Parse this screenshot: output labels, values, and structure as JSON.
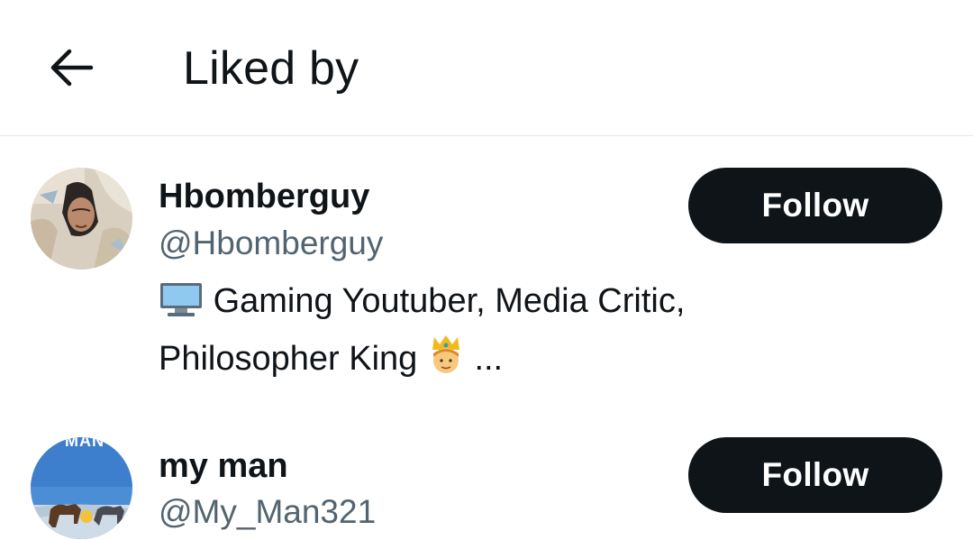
{
  "header": {
    "title": "Liked by",
    "back_icon": "arrow-left-icon"
  },
  "users": [
    {
      "name": "Hbomberguy",
      "handle": "@Hbomberguy",
      "bio_line1": "Gaming Youtuber, Media Critic,",
      "bio_line2": "Philosopher King",
      "bio_trail": "...",
      "bio_icons": [
        "desktop-computer-emoji",
        "prince-emoji"
      ],
      "follow_label": "Follow"
    },
    {
      "name": "my man",
      "handle": "@My_Man321",
      "avatar_text": "MAN",
      "follow_label": "Follow"
    }
  ],
  "colors": {
    "text_primary": "#0f1419",
    "text_secondary": "#536471",
    "button_bg": "#0f1419",
    "button_text": "#ffffff",
    "divider": "#e6e8ea"
  }
}
